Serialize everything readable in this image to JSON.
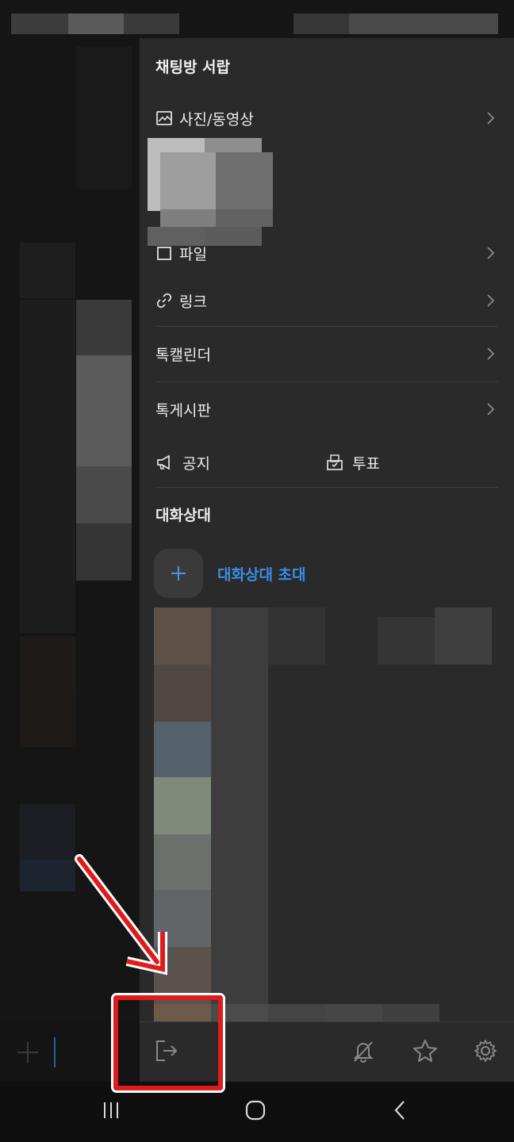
{
  "drawer": {
    "title": "채팅방 서랍",
    "media_label": "사진/동영상",
    "file_label": "파일",
    "link_label": "링크",
    "calendar_label": "톡캘린더",
    "board_label": "톡게시판",
    "notice_label": "공지",
    "vote_label": "투표",
    "members_title": "대화상대",
    "invite_label": "대화상대 초대"
  },
  "icons": {
    "media": "image-icon",
    "file": "file-icon",
    "link": "link-icon",
    "notice": "megaphone-icon",
    "vote": "ballot-box-icon",
    "invite": "plus-icon",
    "leave": "exit-icon",
    "mute": "bell-off-icon",
    "favorite": "star-icon",
    "settings": "gear-icon"
  },
  "colors": {
    "accent": "#3a8ee6",
    "annotation": "#e01b1b",
    "drawer_bg": "#2a2a2a"
  }
}
